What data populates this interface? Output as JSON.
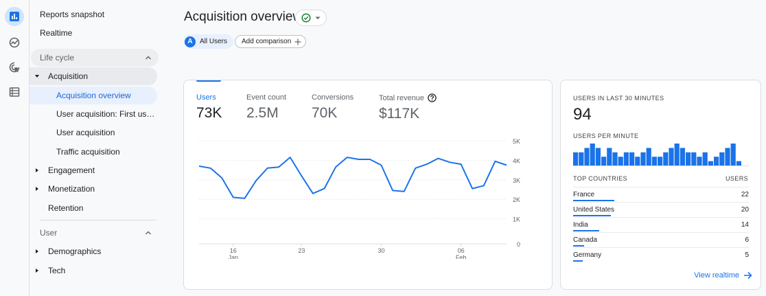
{
  "nav": {
    "reports_snapshot": "Reports snapshot",
    "realtime": "Realtime",
    "lifecycle_header": "Life cycle",
    "acquisition": "Acquisition",
    "acquisition_sub": [
      "Acquisition overview",
      "User acquisition: First user ...",
      "User acquisition",
      "Traffic acquisition"
    ],
    "engagement": "Engagement",
    "monetization": "Monetization",
    "retention": "Retention",
    "user_header": "User",
    "demographics": "Demographics",
    "tech": "Tech"
  },
  "header": {
    "title": "Acquisition overview",
    "comparison_chip": "All Users",
    "comparison_avatar": "A",
    "add_comparison": "Add comparison"
  },
  "metrics": [
    {
      "label": "Users",
      "value": "73K"
    },
    {
      "label": "Event count",
      "value": "2.5M"
    },
    {
      "label": "Conversions",
      "value": "70K"
    },
    {
      "label": "Total revenue",
      "value": "$117K"
    }
  ],
  "chart_data": {
    "type": "line",
    "x_ticks": [
      {
        "day": "16",
        "month": "Jan"
      },
      {
        "day": "23",
        "month": ""
      },
      {
        "day": "30",
        "month": ""
      },
      {
        "day": "06",
        "month": "Feb"
      }
    ],
    "y_ticks": [
      "5K",
      "4K",
      "3K",
      "2K",
      "1K",
      "0"
    ],
    "ylim": [
      0,
      5000
    ],
    "values": [
      3700,
      3600,
      3100,
      2100,
      2050,
      2950,
      3600,
      3650,
      4150,
      3200,
      2300,
      2550,
      3650,
      4150,
      4050,
      4050,
      3750,
      2450,
      2400,
      3600,
      3800,
      4100,
      3900,
      3800,
      2550,
      2700,
      3950,
      3750
    ],
    "series_color": "#1a73e8"
  },
  "realtime": {
    "title": "USERS IN LAST 30 MINUTES",
    "count": "94",
    "per_minute_label": "USERS PER MINUTE",
    "per_minute_values": [
      3,
      3,
      4,
      5,
      4,
      2,
      4,
      3,
      2,
      3,
      3,
      2,
      3,
      4,
      2,
      2,
      3,
      4,
      5,
      4,
      3,
      3,
      2,
      3,
      1,
      2,
      3,
      4,
      5,
      1
    ],
    "bar_color": "#1a73e8",
    "top_countries_label": "TOP COUNTRIES",
    "users_label": "USERS",
    "countries": [
      {
        "name": "France",
        "users": "22"
      },
      {
        "name": "United States",
        "users": "20"
      },
      {
        "name": "India",
        "users": "14"
      },
      {
        "name": "Canada",
        "users": "6"
      },
      {
        "name": "Germany",
        "users": "5"
      }
    ],
    "country_values": [
      22,
      20,
      14,
      6,
      5
    ],
    "link": "View realtime"
  }
}
